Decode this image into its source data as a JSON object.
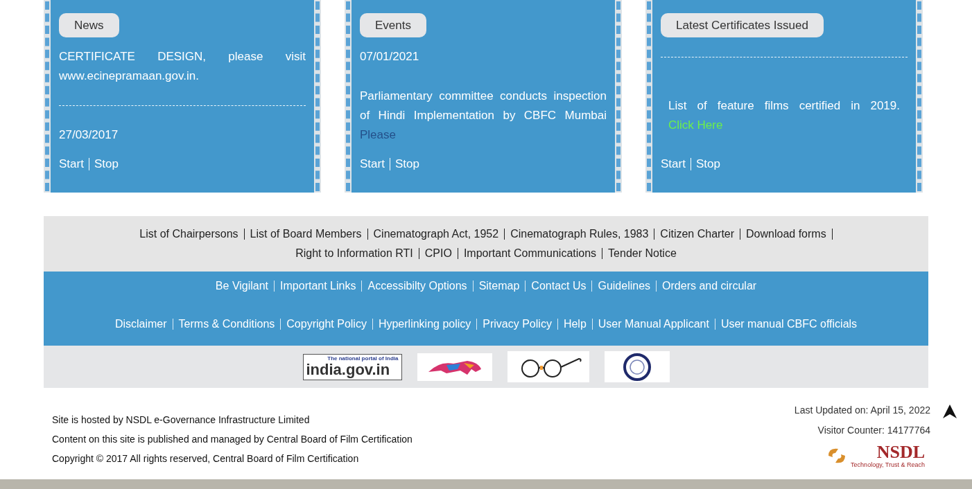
{
  "panels": [
    {
      "title": "News",
      "blocks": [
        {
          "kind": "text",
          "text": "CERTIFICATE DESIGN, please visit www.ecinepramaan.gov.in."
        },
        {
          "kind": "divider"
        },
        {
          "kind": "date",
          "text": "27/03/2017"
        }
      ],
      "controls": [
        "Start",
        "Stop"
      ]
    },
    {
      "title": "Events",
      "blocks": [
        {
          "kind": "date",
          "text": "07/01/2021"
        },
        {
          "kind": "text",
          "text": "Parliamentary committee conducts inspection of Hindi Implementation by CBFC Mumbai",
          "link": {
            "kind": "muted",
            "text": "Please"
          }
        }
      ],
      "controls": [
        "Start",
        "Stop"
      ]
    },
    {
      "title": "Latest Certificates Issued",
      "blocks": [
        {
          "kind": "divider"
        },
        {
          "kind": "text",
          "text": "List of feature films certified in 2019.",
          "link": {
            "kind": "highlight",
            "text": "Click Here"
          },
          "indent": true
        }
      ],
      "controls": [
        "Start",
        "Stop"
      ]
    }
  ],
  "footer": {
    "primary_links": [
      "List of Chairpersons",
      "List of Board Members",
      "Cinematograph Act, 1952",
      "Cinematograph Rules, 1983",
      "Citizen Charter",
      "Download forms",
      "Right to Information RTI",
      "CPIO",
      "Important Communications",
      "Tender Notice"
    ],
    "secondary_links": [
      [
        "Be Vigilant",
        "Important Links",
        "Accessibilty Options",
        "Sitemap",
        "Contact Us",
        "Guidelines",
        "Orders and circular"
      ],
      [
        "Disclaimer",
        "Terms & Conditions",
        "Copyright Policy",
        "Hyperlinking policy",
        "Privacy Policy",
        "Help",
        "User Manual Applicant",
        "User manual CBFC officials"
      ]
    ],
    "logos": [
      {
        "kind": "india_gov",
        "tagline": "The national portal of India",
        "name": "india.gov.in"
      },
      {
        "kind": "make_in_india"
      },
      {
        "kind": "swachh_bharat"
      },
      {
        "kind": "cqw"
      }
    ],
    "info": [
      "Site is hosted by NSDL e-Governance Infrastructure Limited",
      "Content on this site is published and managed by Central Board of Film Certification",
      "Copyright © 2017 All rights reserved, Central Board of Film Certification"
    ],
    "last_updated": "Last Updated on: April 15, 2022",
    "visitor_counter": "Visitor Counter: 14177764",
    "nsdl": {
      "name": "NSDL",
      "tagline": "Technology, Trust & Reach"
    }
  }
}
